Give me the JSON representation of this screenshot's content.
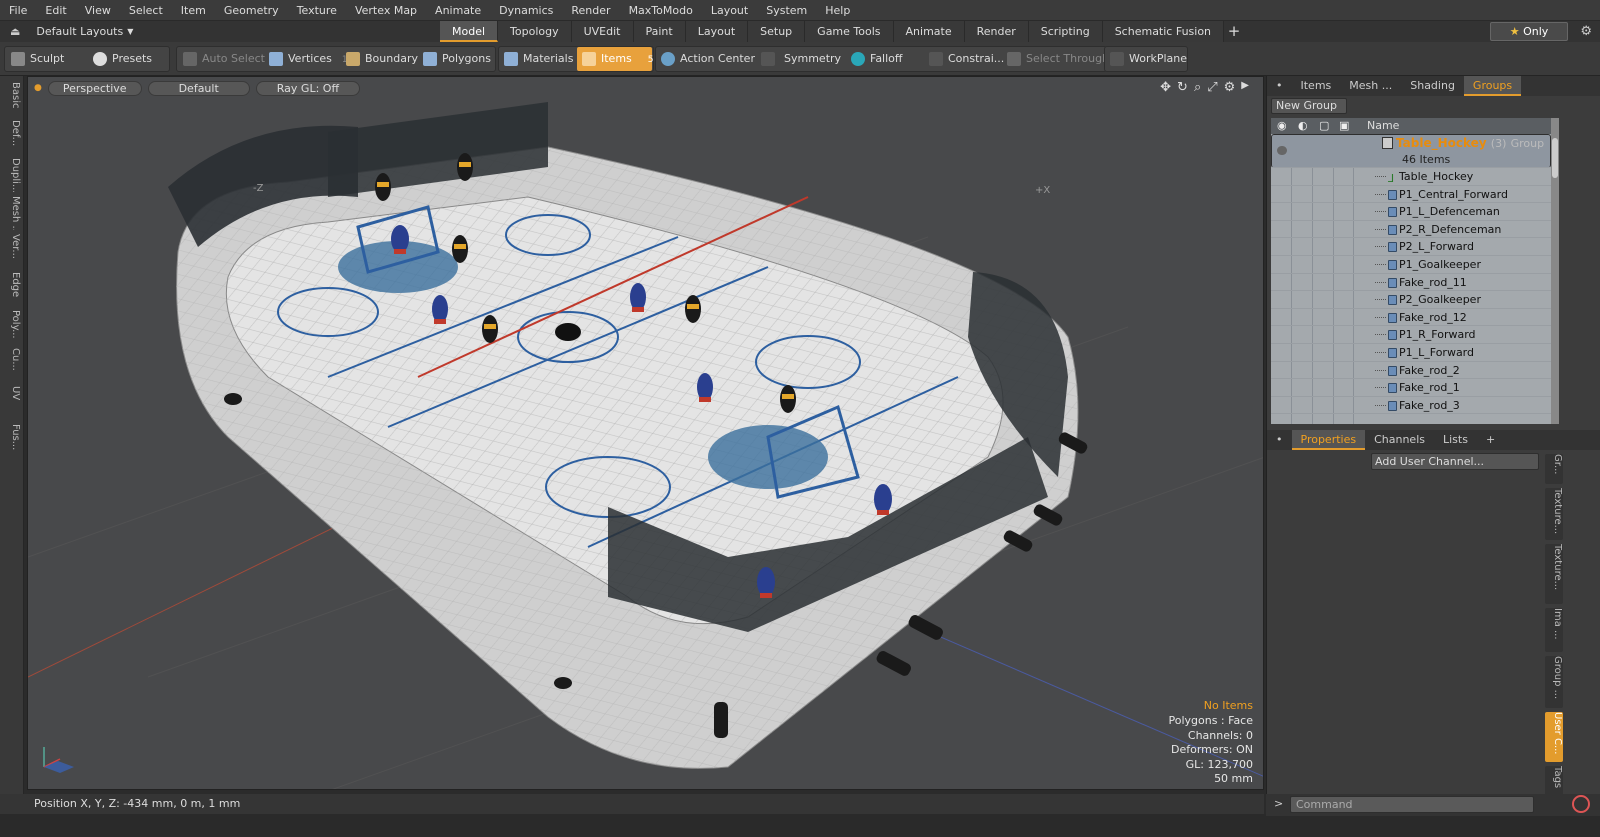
{
  "menubar": [
    "File",
    "Edit",
    "View",
    "Select",
    "Item",
    "Geometry",
    "Texture",
    "Vertex Map",
    "Animate",
    "Dynamics",
    "Render",
    "MaxToModo",
    "Layout",
    "System",
    "Help"
  ],
  "layout_selector": "Default Layouts",
  "layout_tabs": [
    {
      "label": "Model",
      "active": true
    },
    {
      "label": "Topology"
    },
    {
      "label": "UVEdit"
    },
    {
      "label": "Paint"
    },
    {
      "label": "Layout"
    },
    {
      "label": "Setup"
    },
    {
      "label": "Game Tools"
    },
    {
      "label": "Animate"
    },
    {
      "label": "Render"
    },
    {
      "label": "Scripting"
    },
    {
      "label": "Schematic Fusion"
    }
  ],
  "only_button": "Only",
  "toolbar": {
    "sculpt": "Sculpt",
    "presets": "Presets",
    "auto_select": "Auto Select",
    "vertices": "Vertices",
    "vertices_count": "1",
    "boundary": "Boundary",
    "polygons": "Polygons",
    "materials": "Materials",
    "items": "Items",
    "items_count": "5",
    "action_center": "Action Center",
    "symmetry": "Symmetry",
    "falloff": "Falloff",
    "constraints": "Constrai...",
    "select_through": "Select Through",
    "workplane": "WorkPlane"
  },
  "left_tabs": [
    "Basic",
    "Def...",
    "Dupli...",
    "Mesh ...",
    "Ver...",
    "Edge",
    "Poly...",
    "Cu...",
    "UV",
    "Fus..."
  ],
  "viewport": {
    "view": "Perspective",
    "shading": "Default",
    "raygl": "Ray GL: Off",
    "hud": {
      "selection": "No Items",
      "polygons": "Polygons : Face",
      "channels": "Channels: 0",
      "deformers": "Deformers: ON",
      "gl": "GL: 123,700",
      "scale": "50 mm"
    },
    "axis_labels": [
      "-Z",
      "+X"
    ]
  },
  "status": "Position X, Y, Z:  -434 mm, 0 m, 1 mm",
  "colors": {
    "accent": "#e39c2d",
    "viewport_bg": "#48494b",
    "group_name": "#e88c0d"
  },
  "scene_panel": {
    "tabs": [
      {
        "label": "Items"
      },
      {
        "label": "Mesh ..."
      },
      {
        "label": "Shading"
      },
      {
        "label": "Groups",
        "active": true
      }
    ],
    "new_group": "New Group",
    "header_name": "Name",
    "group": {
      "name": "Table_Hockey",
      "count": "(3)",
      "type": "Group",
      "items": "46 Items"
    },
    "rows": [
      "Table_Hockey",
      "P1_Central_Forward",
      "P1_L_Defenceman",
      "P2_R_Defenceman",
      "P2_L_Forward",
      "P1_Goalkeeper",
      "Fake_rod_11",
      "P2_Goalkeeper",
      "Fake_rod_12",
      "P1_R_Forward",
      "P1_L_Forward",
      "Fake_rod_2",
      "Fake_rod_1",
      "Fake_rod_3"
    ]
  },
  "properties_panel": {
    "tabs": [
      {
        "label": "Properties",
        "active": true
      },
      {
        "label": "Channels"
      },
      {
        "label": "Lists"
      }
    ],
    "add_user_channel": "Add User Channel...",
    "side_tabs": [
      "Gr...",
      "Texture...",
      "Texture...",
      "Ima ...",
      "Group ...",
      "User C...",
      "Tags"
    ]
  },
  "command": {
    "placeholder": "Command"
  }
}
